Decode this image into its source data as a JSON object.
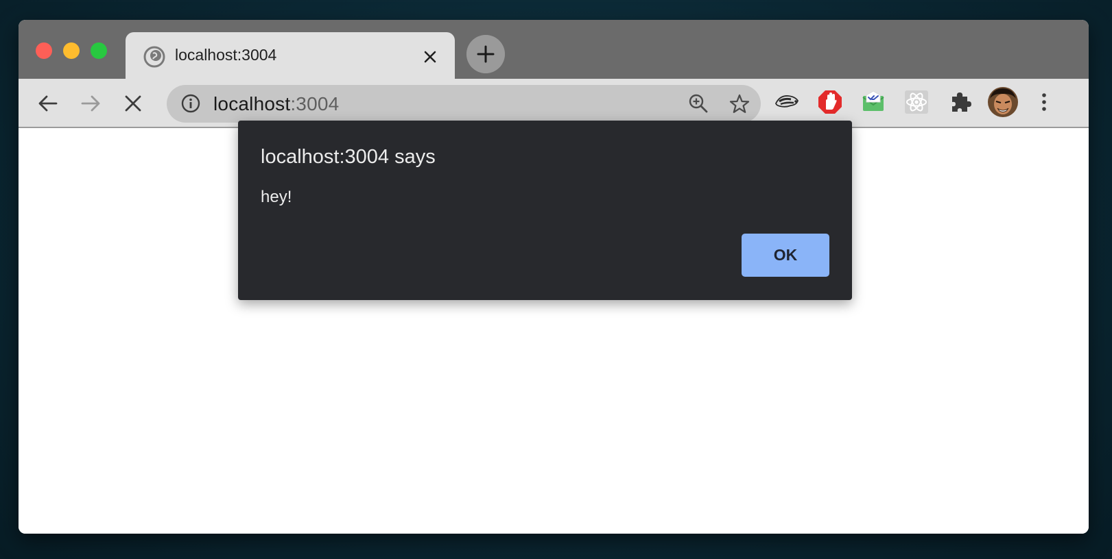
{
  "tab": {
    "title": "localhost:3004",
    "favicon": "globe-icon"
  },
  "toolbar": {
    "url_host": "localhost",
    "url_port": ":3004",
    "back_icon": "arrow-left-icon",
    "forward_icon": "arrow-right-icon",
    "stop_icon": "close-icon"
  },
  "extensions": [
    "privacy-badger-icon",
    "adblock-icon",
    "mail-check-icon",
    "react-devtools-icon",
    "puzzle-icon",
    "avatar"
  ],
  "dialog": {
    "title": "localhost:3004 says",
    "message": "hey!",
    "ok_label": "OK"
  },
  "colors": {
    "titlebar": "#6b6b6b",
    "toolbar": "#e1e1e1",
    "dialog_bg": "#28292d",
    "ok_button": "#8ab4f8",
    "adblock_red": "#e32b2b"
  }
}
